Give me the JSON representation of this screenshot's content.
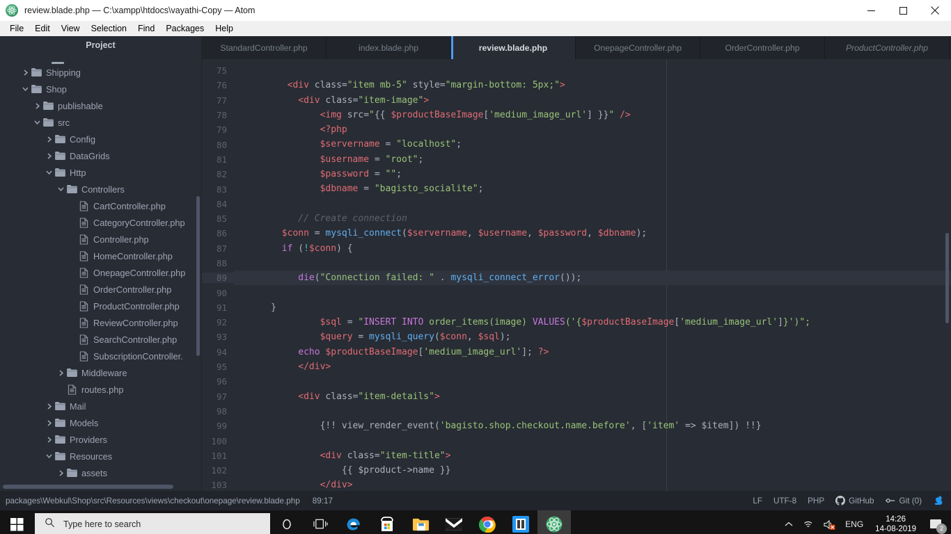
{
  "window": {
    "title": "review.blade.php — C:\\xampp\\htdocs\\vayathi-Copy — Atom",
    "minimize_label": "Minimize",
    "maximize_label": "Maximize",
    "close_label": "Close"
  },
  "menubar": [
    {
      "label": "File"
    },
    {
      "label": "Edit"
    },
    {
      "label": "View"
    },
    {
      "label": "Selection"
    },
    {
      "label": "Find"
    },
    {
      "label": "Packages"
    },
    {
      "label": "Help"
    }
  ],
  "sidebar": {
    "title": "Project",
    "tree": [
      {
        "label": "Shipping",
        "type": "folder",
        "state": "collapsed",
        "depth": 1
      },
      {
        "label": "Shop",
        "type": "folder",
        "state": "expanded",
        "depth": 1
      },
      {
        "label": "publishable",
        "type": "folder",
        "state": "collapsed",
        "depth": 2
      },
      {
        "label": "src",
        "type": "folder",
        "state": "expanded",
        "depth": 2
      },
      {
        "label": "Config",
        "type": "folder",
        "state": "collapsed",
        "depth": 3
      },
      {
        "label": "DataGrids",
        "type": "folder",
        "state": "collapsed",
        "depth": 3
      },
      {
        "label": "Http",
        "type": "folder",
        "state": "expanded",
        "depth": 3
      },
      {
        "label": "Controllers",
        "type": "folder",
        "state": "expanded",
        "depth": 4
      },
      {
        "label": "CartController.php",
        "type": "file",
        "state": "none",
        "depth": 5
      },
      {
        "label": "CategoryController.php",
        "type": "file",
        "state": "none",
        "depth": 5
      },
      {
        "label": "Controller.php",
        "type": "file",
        "state": "none",
        "depth": 5
      },
      {
        "label": "HomeController.php",
        "type": "file",
        "state": "none",
        "depth": 5
      },
      {
        "label": "OnepageController.php",
        "type": "file",
        "state": "none",
        "depth": 5
      },
      {
        "label": "OrderController.php",
        "type": "file",
        "state": "none",
        "depth": 5
      },
      {
        "label": "ProductController.php",
        "type": "file",
        "state": "none",
        "depth": 5
      },
      {
        "label": "ReviewController.php",
        "type": "file",
        "state": "none",
        "depth": 5
      },
      {
        "label": "SearchController.php",
        "type": "file",
        "state": "none",
        "depth": 5
      },
      {
        "label": "SubscriptionController.",
        "type": "file",
        "state": "none",
        "depth": 5
      },
      {
        "label": "Middleware",
        "type": "folder",
        "state": "collapsed",
        "depth": 4
      },
      {
        "label": "routes.php",
        "type": "file",
        "state": "none",
        "depth": 4
      },
      {
        "label": "Mail",
        "type": "folder",
        "state": "collapsed",
        "depth": 3
      },
      {
        "label": "Models",
        "type": "folder",
        "state": "collapsed",
        "depth": 3
      },
      {
        "label": "Providers",
        "type": "folder",
        "state": "collapsed",
        "depth": 3
      },
      {
        "label": "Resources",
        "type": "folder",
        "state": "expanded",
        "depth": 3
      },
      {
        "label": "assets",
        "type": "folder",
        "state": "collapsed",
        "depth": 4
      }
    ]
  },
  "tabs": [
    {
      "label": "StandardController.php",
      "active": false,
      "preview": false
    },
    {
      "label": "index.blade.php",
      "active": false,
      "preview": false
    },
    {
      "label": "review.blade.php",
      "active": true,
      "preview": false
    },
    {
      "label": "OnepageController.php",
      "active": false,
      "preview": false
    },
    {
      "label": "OrderController.php",
      "active": false,
      "preview": false
    },
    {
      "label": "ProductController.php",
      "active": false,
      "preview": true
    }
  ],
  "editor": {
    "first_line": 75,
    "cursor_line": 89,
    "lines": [
      {
        "n": 75,
        "tokens": []
      },
      {
        "n": 76,
        "tokens": [
          {
            "t": "        ",
            "c": "c-plain"
          },
          {
            "t": "<div",
            "c": "c-tag"
          },
          {
            "t": " class",
            "c": "c-attrname"
          },
          {
            "t": "=",
            "c": "c-plain"
          },
          {
            "t": "\"item mb-5\"",
            "c": "c-str"
          },
          {
            "t": " style",
            "c": "c-attrname"
          },
          {
            "t": "=",
            "c": "c-plain"
          },
          {
            "t": "\"margin-bottom: 5px;\"",
            "c": "c-str"
          },
          {
            "t": ">",
            "c": "c-tag"
          }
        ]
      },
      {
        "n": 77,
        "tokens": [
          {
            "t": "          ",
            "c": "c-plain"
          },
          {
            "t": "<div",
            "c": "c-tag"
          },
          {
            "t": " class",
            "c": "c-attrname"
          },
          {
            "t": "=",
            "c": "c-plain"
          },
          {
            "t": "\"item-image\"",
            "c": "c-str"
          },
          {
            "t": ">",
            "c": "c-tag"
          }
        ]
      },
      {
        "n": 78,
        "tokens": [
          {
            "t": "              ",
            "c": "c-plain"
          },
          {
            "t": "<img",
            "c": "c-tag"
          },
          {
            "t": " src",
            "c": "c-attrname"
          },
          {
            "t": "=",
            "c": "c-plain"
          },
          {
            "t": "\"",
            "c": "c-str"
          },
          {
            "t": "{{ ",
            "c": "c-plain"
          },
          {
            "t": "$productBaseImage",
            "c": "c-var"
          },
          {
            "t": "[",
            "c": "c-plain"
          },
          {
            "t": "'medium_image_url'",
            "c": "c-str"
          },
          {
            "t": "]",
            "c": "c-plain"
          },
          {
            "t": " }}",
            "c": "c-plain"
          },
          {
            "t": "\"",
            "c": "c-str"
          },
          {
            "t": " />",
            "c": "c-tag"
          }
        ]
      },
      {
        "n": 79,
        "tokens": [
          {
            "t": "              ",
            "c": "c-plain"
          },
          {
            "t": "<?php",
            "c": "c-tag"
          }
        ]
      },
      {
        "n": 80,
        "tokens": [
          {
            "t": "              ",
            "c": "c-plain"
          },
          {
            "t": "$servername",
            "c": "c-var"
          },
          {
            "t": " = ",
            "c": "c-plain"
          },
          {
            "t": "\"localhost\"",
            "c": "c-str"
          },
          {
            "t": ";",
            "c": "c-plain"
          }
        ]
      },
      {
        "n": 81,
        "tokens": [
          {
            "t": "              ",
            "c": "c-plain"
          },
          {
            "t": "$username",
            "c": "c-var"
          },
          {
            "t": " = ",
            "c": "c-plain"
          },
          {
            "t": "\"root\"",
            "c": "c-str"
          },
          {
            "t": ";",
            "c": "c-plain"
          }
        ]
      },
      {
        "n": 82,
        "tokens": [
          {
            "t": "              ",
            "c": "c-plain"
          },
          {
            "t": "$password",
            "c": "c-var"
          },
          {
            "t": " = ",
            "c": "c-plain"
          },
          {
            "t": "\"\"",
            "c": "c-str"
          },
          {
            "t": ";",
            "c": "c-plain"
          }
        ]
      },
      {
        "n": 83,
        "tokens": [
          {
            "t": "              ",
            "c": "c-plain"
          },
          {
            "t": "$dbname",
            "c": "c-var"
          },
          {
            "t": " = ",
            "c": "c-plain"
          },
          {
            "t": "\"bagisto_socialite\"",
            "c": "c-str"
          },
          {
            "t": ";",
            "c": "c-plain"
          }
        ]
      },
      {
        "n": 84,
        "tokens": []
      },
      {
        "n": 85,
        "tokens": [
          {
            "t": "          ",
            "c": "c-plain"
          },
          {
            "t": "// Create connection",
            "c": "c-comment"
          }
        ]
      },
      {
        "n": 86,
        "tokens": [
          {
            "t": "       ",
            "c": "c-plain"
          },
          {
            "t": "$conn",
            "c": "c-var"
          },
          {
            "t": " = ",
            "c": "c-plain"
          },
          {
            "t": "mysqli_connect",
            "c": "c-fn"
          },
          {
            "t": "(",
            "c": "c-plain"
          },
          {
            "t": "$servername",
            "c": "c-var"
          },
          {
            "t": ", ",
            "c": "c-plain"
          },
          {
            "t": "$username",
            "c": "c-var"
          },
          {
            "t": ", ",
            "c": "c-plain"
          },
          {
            "t": "$password",
            "c": "c-var"
          },
          {
            "t": ", ",
            "c": "c-plain"
          },
          {
            "t": "$dbname",
            "c": "c-var"
          },
          {
            "t": ");",
            "c": "c-plain"
          }
        ]
      },
      {
        "n": 87,
        "tokens": [
          {
            "t": "       ",
            "c": "c-plain"
          },
          {
            "t": "if",
            "c": "c-kw"
          },
          {
            "t": " (",
            "c": "c-plain"
          },
          {
            "t": "!",
            "c": "c-op"
          },
          {
            "t": "$conn",
            "c": "c-var"
          },
          {
            "t": ") {",
            "c": "c-plain"
          }
        ]
      },
      {
        "n": 88,
        "tokens": []
      },
      {
        "n": 89,
        "tokens": [
          {
            "t": "          ",
            "c": "c-plain"
          },
          {
            "t": "die",
            "c": "c-kw"
          },
          {
            "t": "(",
            "c": "c-plain"
          },
          {
            "t": "\"Connection failed: \"",
            "c": "c-str"
          },
          {
            "t": " . ",
            "c": "c-plain"
          },
          {
            "t": "mysqli_connect_error",
            "c": "c-fn"
          },
          {
            "t": "());",
            "c": "c-plain"
          }
        ]
      },
      {
        "n": 90,
        "tokens": []
      },
      {
        "n": 91,
        "tokens": [
          {
            "t": "     }",
            "c": "c-plain"
          }
        ]
      },
      {
        "n": 92,
        "tokens": [
          {
            "t": "              ",
            "c": "c-plain"
          },
          {
            "t": "$sql",
            "c": "c-var"
          },
          {
            "t": " = ",
            "c": "c-plain"
          },
          {
            "t": "\"",
            "c": "c-str"
          },
          {
            "t": "INSERT INTO",
            "c": "c-kw"
          },
          {
            "t": " order_items(image) ",
            "c": "c-str"
          },
          {
            "t": "VALUES",
            "c": "c-kw"
          },
          {
            "t": "('{",
            "c": "c-str"
          },
          {
            "t": "$productBaseImage",
            "c": "c-var"
          },
          {
            "t": "[",
            "c": "c-plain"
          },
          {
            "t": "'medium_image_url'",
            "c": "c-str"
          },
          {
            "t": "]",
            "c": "c-plain"
          },
          {
            "t": "}')\";",
            "c": "c-str"
          }
        ]
      },
      {
        "n": 93,
        "tokens": [
          {
            "t": "              ",
            "c": "c-plain"
          },
          {
            "t": "$query",
            "c": "c-var"
          },
          {
            "t": " = ",
            "c": "c-plain"
          },
          {
            "t": "mysqli_query",
            "c": "c-fn"
          },
          {
            "t": "(",
            "c": "c-plain"
          },
          {
            "t": "$conn",
            "c": "c-var"
          },
          {
            "t": ", ",
            "c": "c-plain"
          },
          {
            "t": "$sql",
            "c": "c-var"
          },
          {
            "t": ");",
            "c": "c-plain"
          }
        ]
      },
      {
        "n": 94,
        "tokens": [
          {
            "t": "          ",
            "c": "c-plain"
          },
          {
            "t": "echo",
            "c": "c-kw"
          },
          {
            "t": " ",
            "c": "c-plain"
          },
          {
            "t": "$productBaseImage",
            "c": "c-var"
          },
          {
            "t": "[",
            "c": "c-plain"
          },
          {
            "t": "'medium_image_url'",
            "c": "c-str"
          },
          {
            "t": "]; ",
            "c": "c-plain"
          },
          {
            "t": "?>",
            "c": "c-tag"
          }
        ]
      },
      {
        "n": 95,
        "tokens": [
          {
            "t": "          ",
            "c": "c-plain"
          },
          {
            "t": "</div>",
            "c": "c-tag"
          }
        ]
      },
      {
        "n": 96,
        "tokens": []
      },
      {
        "n": 97,
        "tokens": [
          {
            "t": "          ",
            "c": "c-plain"
          },
          {
            "t": "<div",
            "c": "c-tag"
          },
          {
            "t": " class",
            "c": "c-attrname"
          },
          {
            "t": "=",
            "c": "c-plain"
          },
          {
            "t": "\"item-details\"",
            "c": "c-str"
          },
          {
            "t": ">",
            "c": "c-tag"
          }
        ]
      },
      {
        "n": 98,
        "tokens": []
      },
      {
        "n": 99,
        "tokens": [
          {
            "t": "              ",
            "c": "c-plain"
          },
          {
            "t": "{!! ",
            "c": "c-plain"
          },
          {
            "t": "view_render_event",
            "c": "c-plain"
          },
          {
            "t": "(",
            "c": "c-plain"
          },
          {
            "t": "'bagisto.shop.checkout.name.before'",
            "c": "c-str"
          },
          {
            "t": ", [",
            "c": "c-plain"
          },
          {
            "t": "'item'",
            "c": "c-str"
          },
          {
            "t": " => ",
            "c": "c-plain"
          },
          {
            "t": "$item",
            "c": "c-plain"
          },
          {
            "t": "]) !!}",
            "c": "c-plain"
          }
        ]
      },
      {
        "n": 100,
        "tokens": []
      },
      {
        "n": 101,
        "tokens": [
          {
            "t": "              ",
            "c": "c-plain"
          },
          {
            "t": "<div",
            "c": "c-tag"
          },
          {
            "t": " class",
            "c": "c-attrname"
          },
          {
            "t": "=",
            "c": "c-plain"
          },
          {
            "t": "\"item-title\"",
            "c": "c-str"
          },
          {
            "t": ">",
            "c": "c-tag"
          }
        ]
      },
      {
        "n": 102,
        "tokens": [
          {
            "t": "                  ",
            "c": "c-plain"
          },
          {
            "t": "{{ ",
            "c": "c-plain"
          },
          {
            "t": "$product->name",
            "c": "c-plain"
          },
          {
            "t": " }}",
            "c": "c-plain"
          }
        ]
      },
      {
        "n": 103,
        "tokens": [
          {
            "t": "              ",
            "c": "c-plain"
          },
          {
            "t": "</div>",
            "c": "c-tag"
          }
        ]
      }
    ]
  },
  "statusbar": {
    "path": "packages\\Webkul\\Shop\\src\\Resources\\views\\checkout\\onepage\\review.blade.php",
    "cursor_position": "89:17",
    "line_ending": "LF",
    "encoding": "UTF-8",
    "grammar": "PHP",
    "github": "GitHub",
    "git": "Git (0)"
  },
  "taskbar": {
    "search_placeholder": "Type here to search",
    "time": "14:26",
    "date": "14-08-2019",
    "language": "ENG",
    "notification_count": "2",
    "icons": [
      {
        "name": "cortana-icon"
      },
      {
        "name": "task-view-icon"
      },
      {
        "name": "edge-icon"
      },
      {
        "name": "microsoft-store-icon"
      },
      {
        "name": "file-explorer-icon"
      },
      {
        "name": "mail-icon"
      },
      {
        "name": "chrome-icon"
      },
      {
        "name": "sublime-text-icon"
      },
      {
        "name": "atom-icon"
      }
    ]
  }
}
